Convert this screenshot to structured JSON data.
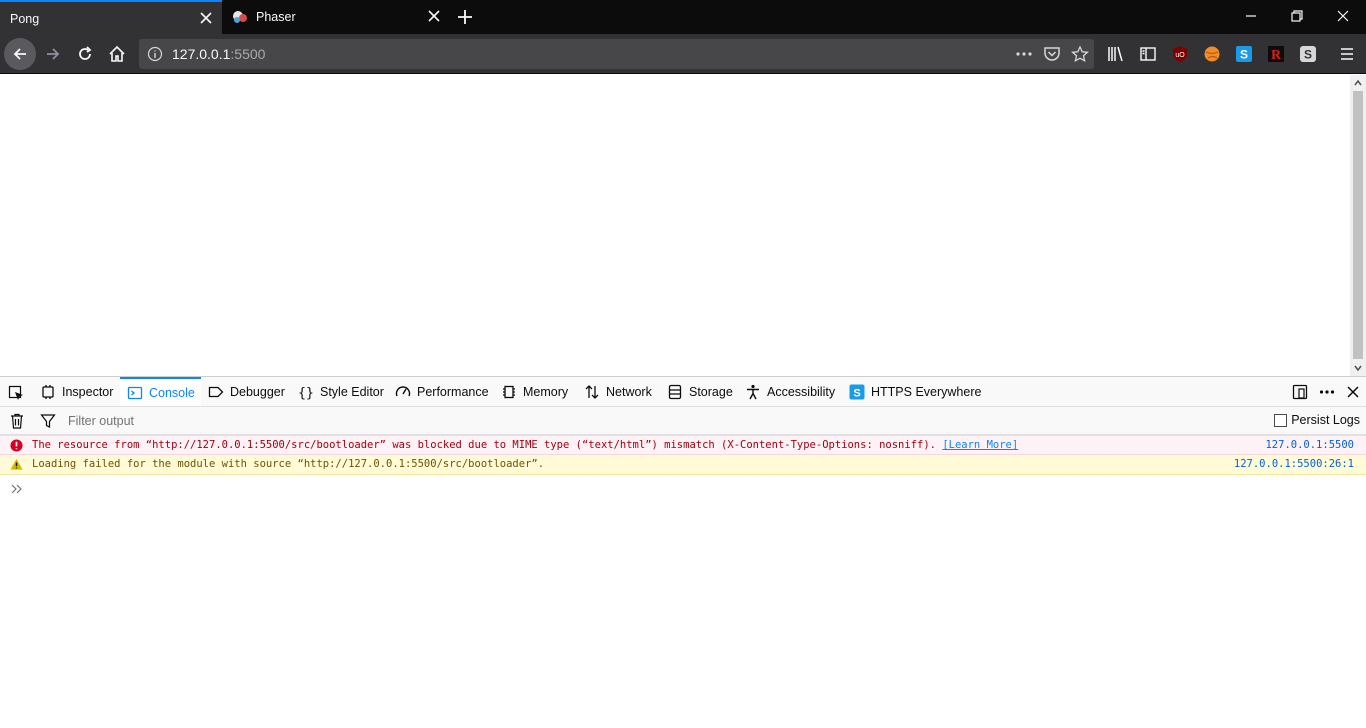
{
  "tabs": [
    {
      "title": "Pong",
      "active": true
    },
    {
      "title": "Phaser",
      "active": false
    }
  ],
  "navbar": {
    "url_host": "127.0.0.1",
    "url_port": ":5500"
  },
  "devtools": {
    "tabs": [
      {
        "label": "Inspector",
        "icon": "inspector-icon"
      },
      {
        "label": "Console",
        "icon": "console-icon",
        "selected": true
      },
      {
        "label": "Debugger",
        "icon": "debugger-icon"
      },
      {
        "label": "Style Editor",
        "icon": "style-editor-icon"
      },
      {
        "label": "Performance",
        "icon": "performance-icon"
      },
      {
        "label": "Memory",
        "icon": "memory-icon"
      },
      {
        "label": "Network",
        "icon": "network-icon"
      },
      {
        "label": "Storage",
        "icon": "storage-icon"
      },
      {
        "label": "Accessibility",
        "icon": "accessibility-icon"
      },
      {
        "label": "HTTPS Everywhere",
        "icon": "https-everywhere-icon"
      }
    ],
    "filter_placeholder": "Filter output",
    "persist_logs": "Persist Logs",
    "messages": [
      {
        "level": "error",
        "text": "The resource from “http://127.0.0.1:5500/src/bootloader” was blocked due to MIME type (“text/html”) mismatch (X-Content-Type-Options: nosniff).",
        "link": "[Learn More]",
        "source": "127.0.0.1:5500"
      },
      {
        "level": "warning",
        "text": "Loading failed for the module with source “http://127.0.0.1:5500/src/bootloader”.",
        "source": "127.0.0.1:5500:26:1"
      }
    ]
  },
  "colors": {
    "accent": "#0a84ff",
    "tabstrip_bg": "#0c0c0d",
    "navbar_bg": "#323234",
    "error_bg": "#fdf2f5",
    "warning_bg": "#fffbd6"
  }
}
